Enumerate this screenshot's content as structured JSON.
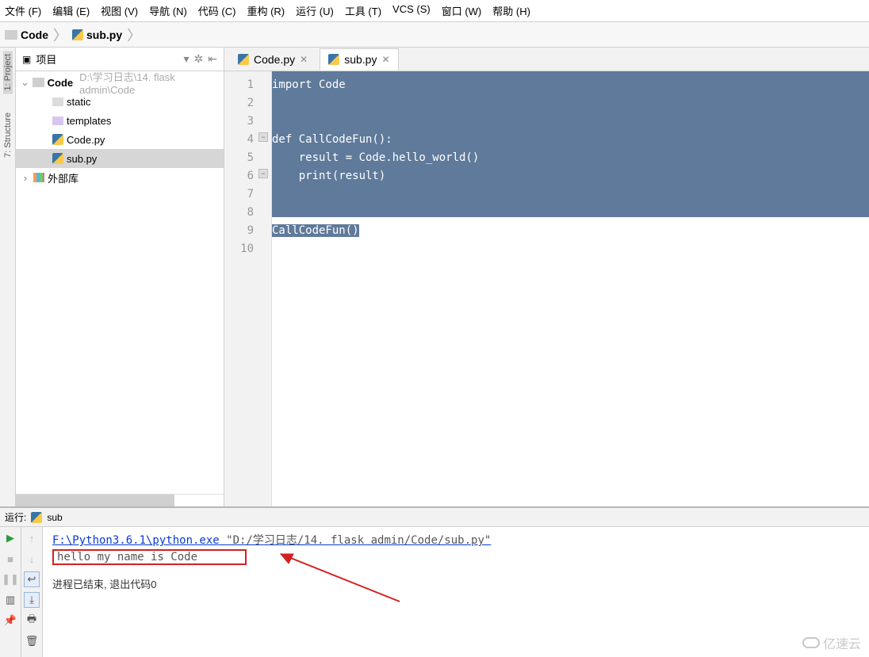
{
  "menu": {
    "file": "文件 (F)",
    "edit": "编辑 (E)",
    "view": "视图 (V)",
    "navigate": "导航 (N)",
    "code": "代码 (C)",
    "refactor": "重构 (R)",
    "run": "运行 (U)",
    "tools": "工具 (T)",
    "vcs": "VCS (S)",
    "window": "窗口 (W)",
    "help": "帮助 (H)"
  },
  "breadcrumb": {
    "root": "Code",
    "file": "sub.py"
  },
  "sidebar": {
    "project": "1: Project",
    "structure": "7: Structure"
  },
  "project": {
    "panel_title": "项目",
    "root": {
      "name": "Code",
      "path": "D:\\学习日志\\14. flask admin\\Code"
    },
    "children": {
      "static": "static",
      "templates": "templates",
      "codepy": "Code.py",
      "subpy": "sub.py"
    },
    "external": "外部库"
  },
  "tabs": {
    "code": "Code.py",
    "sub": "sub.py"
  },
  "code": {
    "l1": "import Code",
    "l2": "",
    "l3": "",
    "l4": "def CallCodeFun():",
    "l5": "    result = Code.hello_world()",
    "l6": "    print(result)",
    "l7": "",
    "l8": "",
    "l9": "CallCodeFun()",
    "l10": ""
  },
  "linenos": {
    "n1": "1",
    "n2": "2",
    "n3": "3",
    "n4": "4",
    "n5": "5",
    "n6": "6",
    "n7": "7",
    "n8": "8",
    "n9": "9",
    "n10": "10"
  },
  "run": {
    "label": "运行:",
    "config": "sub",
    "cmd_path": "F:\\Python3.6.1\\python.exe",
    "cmd_arg": "\"D:/学习日志/14. flask admin/Code/sub.py\"",
    "output": "hello my name is Code",
    "exit": "进程已结束, 退出代码0"
  },
  "watermark": "亿速云"
}
